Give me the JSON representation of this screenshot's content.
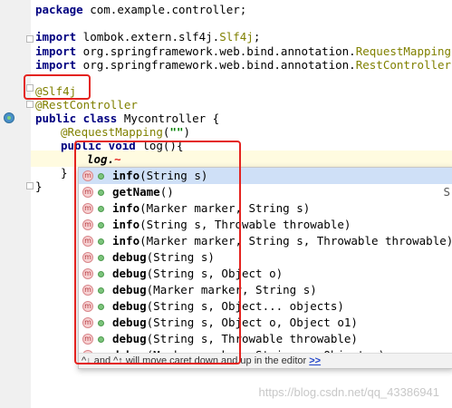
{
  "code": {
    "line_package": {
      "kw": "package",
      "rest": " com.example.controller;"
    },
    "import1": {
      "kw": "import",
      "pre": " lombok.extern.slf4j.",
      "ann": "Slf4j",
      "post": ";"
    },
    "import2": {
      "kw": "import",
      "pre": " org.springframework.web.bind.annotation.",
      "ann": "RequestMapping",
      "post": ";"
    },
    "import3": {
      "kw": "import",
      "pre": " org.springframework.web.bind.annotation.",
      "ann": "RestController",
      "post": ";"
    },
    "slf4j": "@Slf4j",
    "restcontroller": "@RestController",
    "class_kw": "public class",
    "class_rest": " Mycontroller {",
    "req_ann": "@RequestMapping",
    "req_open": "(",
    "req_str": "\"\"",
    "req_close": ")",
    "method_kw": "public void",
    "method_rest": " log(){",
    "typed": "log.",
    "caret_mark": "~",
    "close_inner": "}",
    "close_outer": "}"
  },
  "completion": {
    "items": [
      {
        "name": "info",
        "params": "(String s)",
        "tail": ""
      },
      {
        "name": "getName",
        "params": "()",
        "tail": "S"
      },
      {
        "name": "info",
        "params": "(Marker marker, String s)",
        "tail": ""
      },
      {
        "name": "info",
        "params": "(String s, Throwable throwable)",
        "tail": ""
      },
      {
        "name": "info",
        "params": "(Marker marker, String s, Throwable throwable)",
        "tail": ""
      },
      {
        "name": "debug",
        "params": "(String s)",
        "tail": ""
      },
      {
        "name": "debug",
        "params": "(String s, Object o)",
        "tail": ""
      },
      {
        "name": "debug",
        "params": "(Marker marker, String s)",
        "tail": ""
      },
      {
        "name": "debug",
        "params": "(String s, Object... objects)",
        "tail": ""
      },
      {
        "name": "debug",
        "params": "(String s, Object o, Object o1)",
        "tail": ""
      },
      {
        "name": "debug",
        "params": "(String s, Throwable throwable)",
        "tail": ""
      },
      {
        "name": "debug",
        "params": "(Marker marker, String s, Object o)",
        "tail": ""
      }
    ],
    "method_icon": "m",
    "footer_text": "^↓ and ^↑ will move caret down and up in the editor ",
    "footer_link": ">>"
  },
  "watermark": "https://blog.csdn.net/qq_43386941",
  "colors": {
    "highlight_red": "#e4231f",
    "selection": "#cfe0f7",
    "keyword": "#000080",
    "annotation": "#808000"
  }
}
